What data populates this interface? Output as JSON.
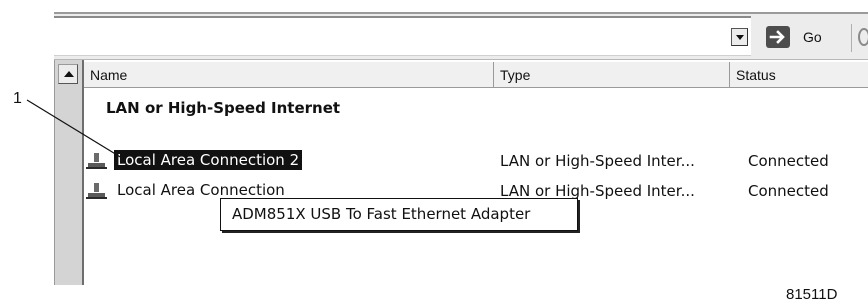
{
  "toolbar": {
    "go_label": "Go"
  },
  "columns": [
    {
      "label": "Name"
    },
    {
      "label": "Type"
    },
    {
      "label": "Status"
    }
  ],
  "group": {
    "title": "LAN or High-Speed Internet"
  },
  "rows": [
    {
      "name": "Local Area Connection 2",
      "type": "LAN or High-Speed Inter...",
      "status": "Connected",
      "selected": true
    },
    {
      "name": "Local Area Connection",
      "type": "LAN or High-Speed Inter...",
      "status": "Connected",
      "selected": false
    }
  ],
  "tooltip": {
    "text": "ADM851X USB To Fast Ethernet Adapter"
  },
  "callout": {
    "number": "1"
  },
  "figure_code": "81511D",
  "icons": [
    "dropdown-arrow-icon",
    "go-arrow-icon",
    "network-connection-icon",
    "scroll-up-arrow-icon"
  ]
}
